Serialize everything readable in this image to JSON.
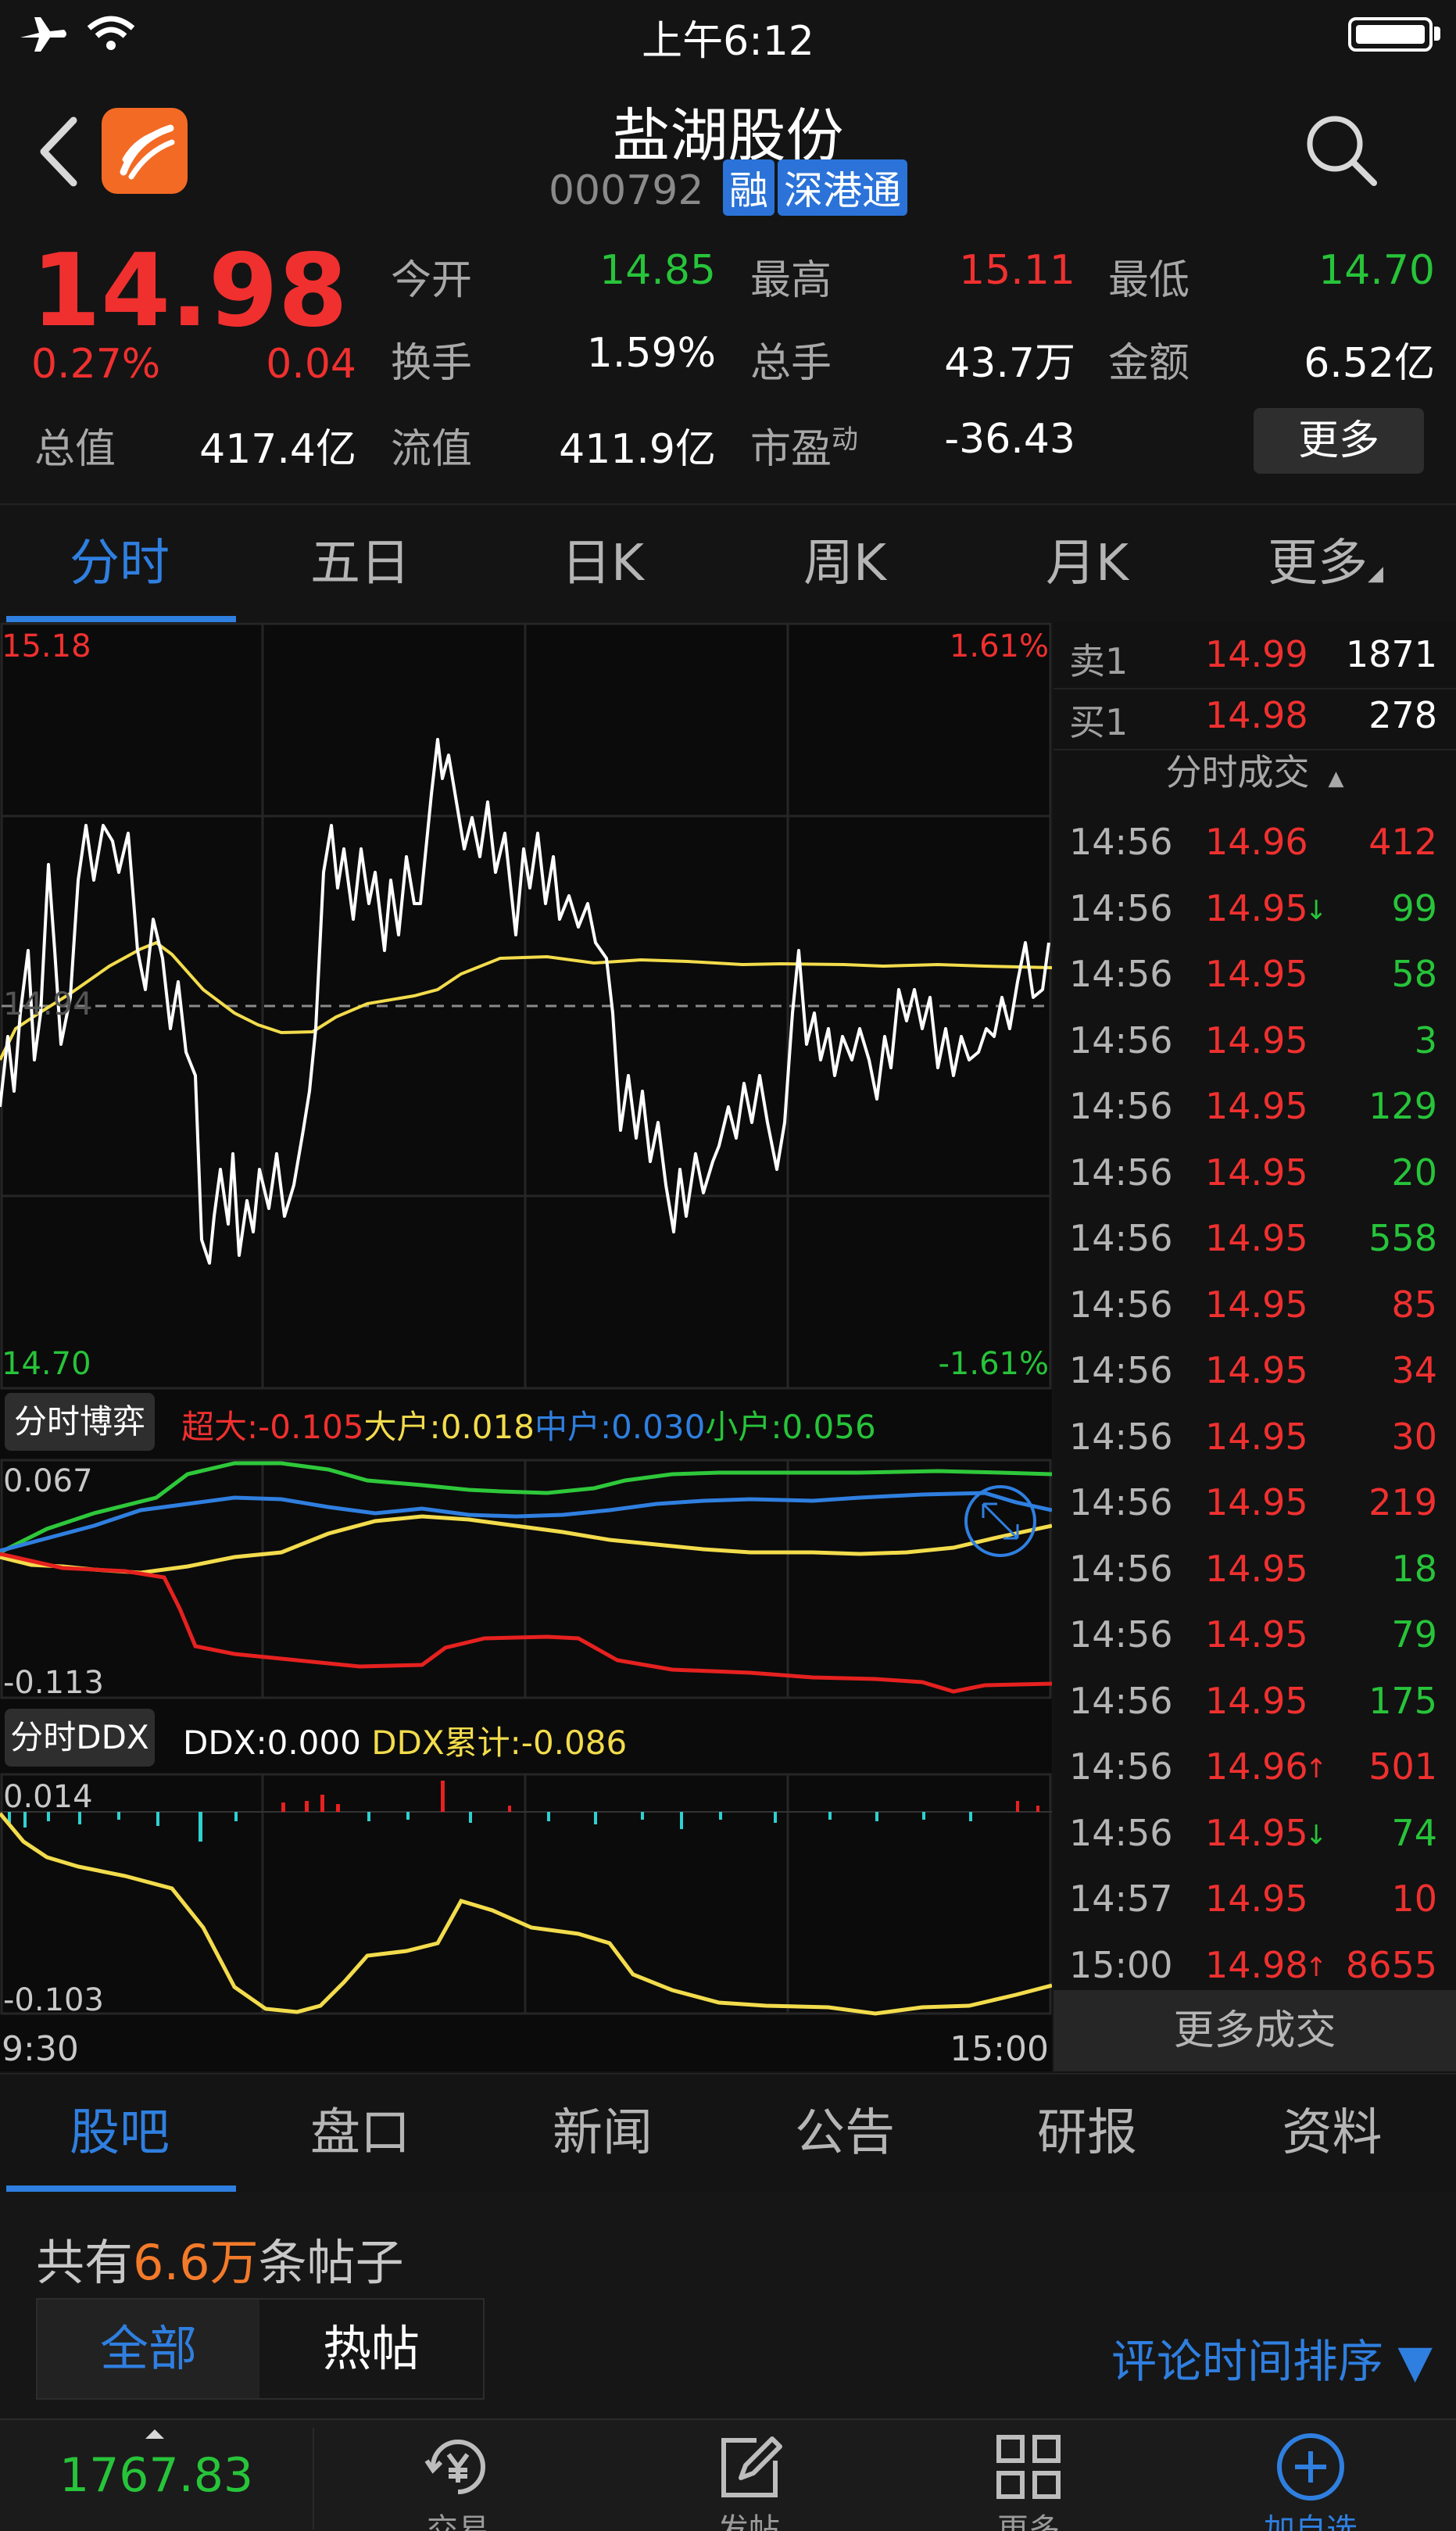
{
  "status_bar": {
    "time": "上午6:12"
  },
  "header": {
    "title": "盐湖股份",
    "code": "000792",
    "tag_margin": "融",
    "tag_connect": "深港通"
  },
  "quote": {
    "price": "14.98",
    "change_pct": "0.27%",
    "change": "0.04",
    "open_label": "今开",
    "open": "14.85",
    "high_label": "最高",
    "high": "15.11",
    "low_label": "最低",
    "low": "14.70",
    "turnover_label": "换手",
    "turnover": "1.59%",
    "volume_label": "总手",
    "volume": "43.7万",
    "amount_label": "金额",
    "amount": "6.52亿",
    "mktcap_label": "总值",
    "mktcap": "417.4亿",
    "float_label": "流值",
    "float": "411.9亿",
    "pe_label": "市盈",
    "pe_sup": "动",
    "pe": "-36.43",
    "more_label": "更多"
  },
  "chart_tabs": [
    "分时",
    "五日",
    "日K",
    "周K",
    "月K",
    "更多"
  ],
  "intraday": {
    "max_price": "15.18",
    "min_price": "14.70",
    "max_pct": "1.61%",
    "min_pct": "-1.61%",
    "ref_price": "14.94",
    "time_start": "9:30",
    "time_end": "15:00"
  },
  "game_panel": {
    "label": "分时博弈",
    "super_large": "超大:-0.105",
    "large": "大户:0.018",
    "medium": "中户:0.030",
    "small": "小户:0.056",
    "axis_max": "0.067",
    "axis_min": "-0.113"
  },
  "ddx_panel": {
    "label": "分时DDX",
    "ddx": "DDX:0.000",
    "ddx_cum": "DDX累计:-0.086",
    "axis_max": "0.014",
    "axis_min": "-0.103"
  },
  "order_book": {
    "ask": {
      "label": "卖1",
      "price": "14.99",
      "qty": "1871"
    },
    "bid": {
      "label": "买1",
      "price": "14.98",
      "qty": "278"
    },
    "trades_title": "分时成交",
    "trades": [
      {
        "time": "14:56",
        "price": "14.96",
        "qty": "412",
        "dir": "",
        "qty_color": "red"
      },
      {
        "time": "14:56",
        "price": "14.95",
        "qty": "99",
        "dir": "↓",
        "qty_color": "green"
      },
      {
        "time": "14:56",
        "price": "14.95",
        "qty": "58",
        "dir": "",
        "qty_color": "green"
      },
      {
        "time": "14:56",
        "price": "14.95",
        "qty": "3",
        "dir": "",
        "qty_color": "green"
      },
      {
        "time": "14:56",
        "price": "14.95",
        "qty": "129",
        "dir": "",
        "qty_color": "green"
      },
      {
        "time": "14:56",
        "price": "14.95",
        "qty": "20",
        "dir": "",
        "qty_color": "green"
      },
      {
        "time": "14:56",
        "price": "14.95",
        "qty": "558",
        "dir": "",
        "qty_color": "green"
      },
      {
        "time": "14:56",
        "price": "14.95",
        "qty": "85",
        "dir": "",
        "qty_color": "red"
      },
      {
        "time": "14:56",
        "price": "14.95",
        "qty": "34",
        "dir": "",
        "qty_color": "red"
      },
      {
        "time": "14:56",
        "price": "14.95",
        "qty": "30",
        "dir": "",
        "qty_color": "red"
      },
      {
        "time": "14:56",
        "price": "14.95",
        "qty": "219",
        "dir": "",
        "qty_color": "red"
      },
      {
        "time": "14:56",
        "price": "14.95",
        "qty": "18",
        "dir": "",
        "qty_color": "green"
      },
      {
        "time": "14:56",
        "price": "14.95",
        "qty": "79",
        "dir": "",
        "qty_color": "green"
      },
      {
        "time": "14:56",
        "price": "14.95",
        "qty": "175",
        "dir": "",
        "qty_color": "green"
      },
      {
        "time": "14:56",
        "price": "14.96",
        "qty": "501",
        "dir": "↑",
        "qty_color": "red"
      },
      {
        "time": "14:56",
        "price": "14.95",
        "qty": "74",
        "dir": "↓",
        "qty_color": "green"
      },
      {
        "time": "14:57",
        "price": "14.95",
        "qty": "10",
        "dir": "",
        "qty_color": "red"
      },
      {
        "time": "15:00",
        "price": "14.98",
        "qty": "8655",
        "dir": "↑",
        "qty_color": "red"
      }
    ],
    "more_trades": "更多成交"
  },
  "info_tabs": [
    "股吧",
    "盘口",
    "新闻",
    "公告",
    "研报",
    "资料"
  ],
  "posts": {
    "count_prefix": "共有",
    "count": "6.6万",
    "count_suffix": "条帖子",
    "filter_all": "全部",
    "filter_hot": "热帖",
    "sort": "评论时间排序 ▼"
  },
  "bottom_nav": {
    "index_value": "1767.83",
    "items": [
      "",
      "交易",
      "发帖",
      "更多",
      "加自选"
    ]
  }
}
